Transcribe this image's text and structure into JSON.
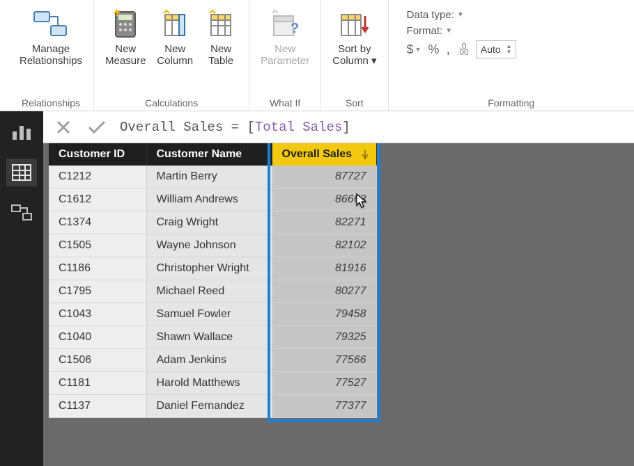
{
  "ribbon": {
    "groups": {
      "relationships": {
        "caption": "Relationships",
        "manage": "Manage\nRelationships"
      },
      "calculations": {
        "caption": "Calculations",
        "new_measure": "New\nMeasure",
        "new_column": "New\nColumn",
        "new_table": "New\nTable"
      },
      "whatif": {
        "caption": "What If",
        "new_parameter": "New\nParameter"
      },
      "sort": {
        "caption": "Sort",
        "sort_by_column": "Sort by\nColumn ▾"
      },
      "formatting": {
        "caption": "Formatting",
        "data_type": "Data type:",
        "format": "Format:",
        "auto_label": "Auto",
        "currency": "$",
        "percent": "%",
        "comma": ",",
        "precision_icon": ".00"
      }
    }
  },
  "formula": {
    "lhs": "Overall Sales",
    "eq": "=",
    "field": "Total Sales"
  },
  "table": {
    "columns": {
      "c0": "Customer ID",
      "c1": "Customer Name",
      "c2": "Overall Sales"
    },
    "rows": [
      {
        "id": "C1212",
        "name": "Martin Berry",
        "val": "87727"
      },
      {
        "id": "C1612",
        "name": "William Andrews",
        "val": "86663"
      },
      {
        "id": "C1374",
        "name": "Craig Wright",
        "val": "82271"
      },
      {
        "id": "C1505",
        "name": "Wayne Johnson",
        "val": "82102"
      },
      {
        "id": "C1186",
        "name": "Christopher Wright",
        "val": "81916"
      },
      {
        "id": "C1795",
        "name": "Michael Reed",
        "val": "80277"
      },
      {
        "id": "C1043",
        "name": "Samuel Fowler",
        "val": "79458"
      },
      {
        "id": "C1040",
        "name": "Shawn Wallace",
        "val": "79325"
      },
      {
        "id": "C1506",
        "name": "Adam Jenkins",
        "val": "77566"
      },
      {
        "id": "C1181",
        "name": "Harold Matthews",
        "val": "77527"
      },
      {
        "id": "C1137",
        "name": "Daniel Fernandez",
        "val": "77377"
      }
    ]
  },
  "colors": {
    "accent": "#f2c811",
    "highlight": "#1d7fd6"
  }
}
